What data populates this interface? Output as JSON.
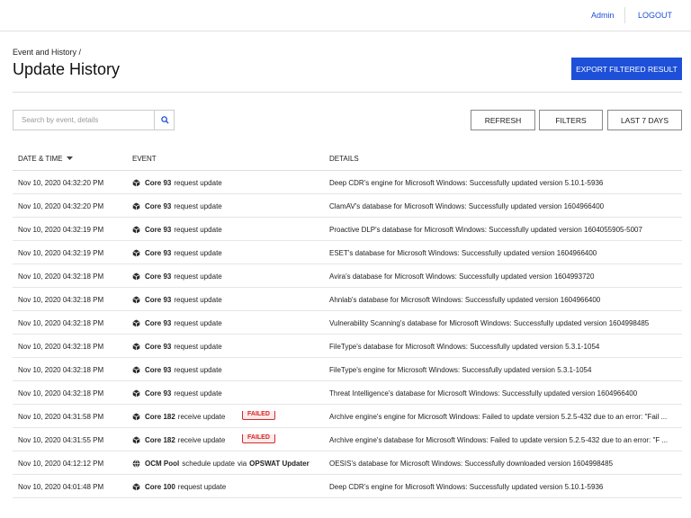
{
  "topbar": {
    "admin_label": "Admin",
    "logout_label": "LOGOUT"
  },
  "header": {
    "breadcrumb": "Event and History /",
    "title": "Update History",
    "export_label": "EXPORT FILTERED RESULT"
  },
  "toolbar": {
    "search_placeholder": "Search by event, details",
    "search_value": "",
    "refresh_label": "REFRESH",
    "filters_label": "FILTERS",
    "range_label": "LAST 7 DAYS"
  },
  "table": {
    "columns": {
      "date": "DATE & TIME",
      "event": "EVENT",
      "details": "DETAILS"
    },
    "rows": [
      {
        "date": "Nov 10, 2020 04:32:20 PM",
        "ev_icon": "box-icon",
        "ev_name": "Core 93",
        "ev_text": "request update",
        "ev_extra": "",
        "ev_target": "",
        "status": "",
        "details": "Deep CDR's engine for Microsoft Windows: Successfully updated version 5.10.1-5936"
      },
      {
        "date": "Nov 10, 2020 04:32:20 PM",
        "ev_icon": "box-icon",
        "ev_name": "Core 93",
        "ev_text": "request update",
        "ev_extra": "",
        "ev_target": "",
        "status": "",
        "details": "ClamAV's database for Microsoft Windows: Successfully updated version 1604966400"
      },
      {
        "date": "Nov 10, 2020 04:32:19 PM",
        "ev_icon": "box-icon",
        "ev_name": "Core 93",
        "ev_text": "request update",
        "ev_extra": "",
        "ev_target": "",
        "status": "",
        "details": "Proactive DLP's database for Microsoft Windows: Successfully updated version 1604055905-5007"
      },
      {
        "date": "Nov 10, 2020 04:32:19 PM",
        "ev_icon": "box-icon",
        "ev_name": "Core 93",
        "ev_text": "request update",
        "ev_extra": "",
        "ev_target": "",
        "status": "",
        "details": "ESET's database for Microsoft Windows: Successfully updated version 1604966400"
      },
      {
        "date": "Nov 10, 2020 04:32:18 PM",
        "ev_icon": "box-icon",
        "ev_name": "Core 93",
        "ev_text": "request update",
        "ev_extra": "",
        "ev_target": "",
        "status": "",
        "details": "Avira's database for Microsoft Windows: Successfully updated version 1604993720"
      },
      {
        "date": "Nov 10, 2020 04:32:18 PM",
        "ev_icon": "box-icon",
        "ev_name": "Core 93",
        "ev_text": "request update",
        "ev_extra": "",
        "ev_target": "",
        "status": "",
        "details": "Ahnlab's database for Microsoft Windows: Successfully updated version 1604966400"
      },
      {
        "date": "Nov 10, 2020 04:32:18 PM",
        "ev_icon": "box-icon",
        "ev_name": "Core 93",
        "ev_text": "request update",
        "ev_extra": "",
        "ev_target": "",
        "status": "",
        "details": "Vulnerability Scanning's database for Microsoft Windows: Successfully updated version 1604998485"
      },
      {
        "date": "Nov 10, 2020 04:32:18 PM",
        "ev_icon": "box-icon",
        "ev_name": "Core 93",
        "ev_text": "request update",
        "ev_extra": "",
        "ev_target": "",
        "status": "",
        "details": "FileType's database for Microsoft Windows: Successfully updated version 5.3.1-1054"
      },
      {
        "date": "Nov 10, 2020 04:32:18 PM",
        "ev_icon": "box-icon",
        "ev_name": "Core 93",
        "ev_text": "request update",
        "ev_extra": "",
        "ev_target": "",
        "status": "",
        "details": "FileType's engine for Microsoft Windows: Successfully updated version 5.3.1-1054"
      },
      {
        "date": "Nov 10, 2020 04:32:18 PM",
        "ev_icon": "box-icon",
        "ev_name": "Core 93",
        "ev_text": "request update",
        "ev_extra": "",
        "ev_target": "",
        "status": "",
        "details": "Threat Intelligence's database for Microsoft Windows: Successfully updated version 1604966400"
      },
      {
        "date": "Nov 10, 2020 04:31:58 PM",
        "ev_icon": "box-icon",
        "ev_name": "Core 182",
        "ev_text": "receive update",
        "ev_extra": "",
        "ev_target": "",
        "status": "FAILED",
        "details": "Archive engine's engine for Microsoft Windows: Failed to update version 5.2.5-432 due to an error: \"Fail ..."
      },
      {
        "date": "Nov 10, 2020 04:31:55 PM",
        "ev_icon": "box-icon",
        "ev_name": "Core 182",
        "ev_text": "receive update",
        "ev_extra": "",
        "ev_target": "",
        "status": "FAILED",
        "details": "Archive engine's database for Microsoft Windows: Failed to update version 5.2.5-432 due to an error: \"F ..."
      },
      {
        "date": "Nov 10, 2020 04:12:12 PM",
        "ev_icon": "globe-icon",
        "ev_name": "OCM Pool",
        "ev_text": "schedule update",
        "ev_extra": "via",
        "ev_target": "OPSWAT Updater",
        "status": "",
        "details": "OESIS's database for Microsoft Windows: Successfully downloaded version 1604998485"
      },
      {
        "date": "Nov 10, 2020 04:01:48 PM",
        "ev_icon": "box-icon",
        "ev_name": "Core 100",
        "ev_text": "request update",
        "ev_extra": "",
        "ev_target": "",
        "status": "",
        "details": "Deep CDR's engine for Microsoft Windows: Successfully updated version 5.10.1-5936"
      }
    ]
  }
}
